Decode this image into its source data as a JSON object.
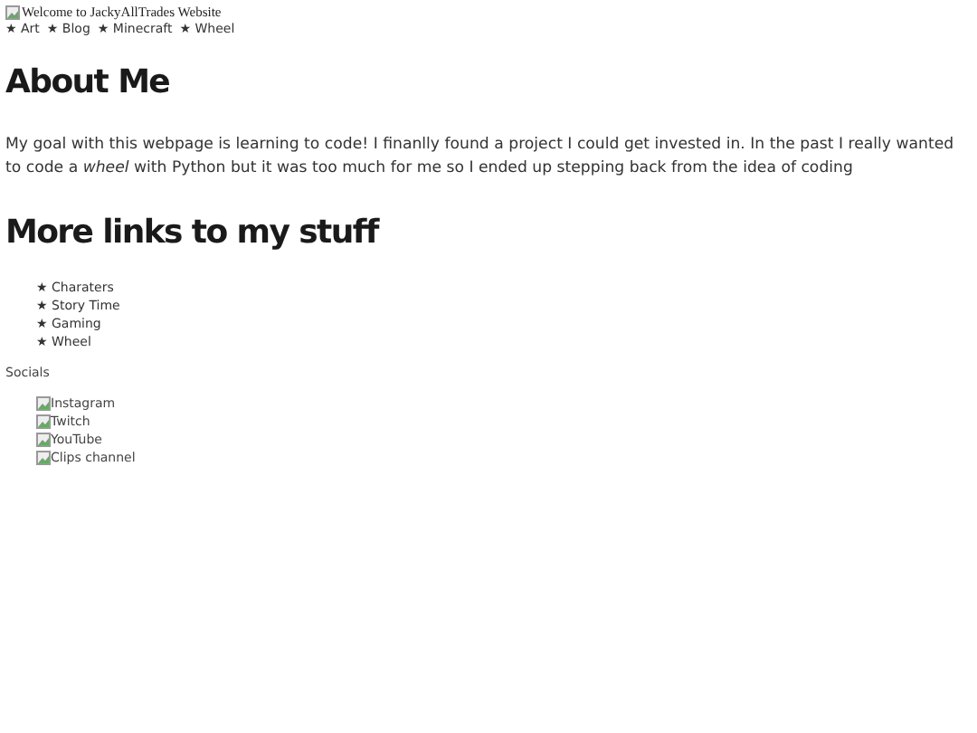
{
  "banner": {
    "alt": "Welcome to JackyAllTrades Website"
  },
  "nav": [
    "★ Art",
    "★ Blog",
    "★ Minecraft",
    "★ Wheel"
  ],
  "about": {
    "heading": "About Me",
    "text": "My goal with this webpage is learning to code! I finanlly found a project I could get invested in. In the past I really wanted to code a *wheel* with Python but it was too much for me so I ended up stepping back from the idea of coding"
  },
  "links": {
    "heading": "More links to my stuff",
    "items": [
      "★ Charaters",
      "★ Story Time",
      "★ Gaming",
      "★ Wheel"
    ]
  },
  "socials": {
    "label": "Socials",
    "items": [
      "Instagram",
      "Twitch",
      "YouTube",
      "Clips channel"
    ]
  }
}
